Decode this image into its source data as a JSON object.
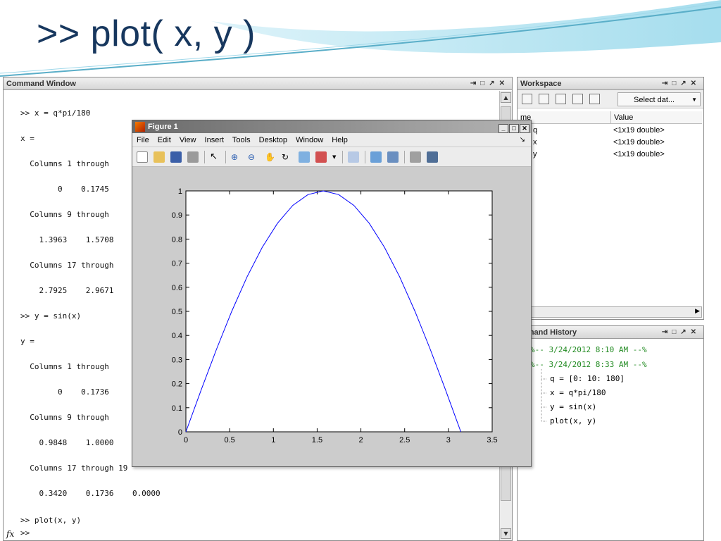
{
  "slide": {
    "title": ">> plot( x, y )"
  },
  "command_window": {
    "title": "Command Window",
    "lines": [
      ">> x = q*pi/180",
      "x =",
      "  Columns 1 through",
      "        0    0.1745",
      "  Columns 9 through",
      "    1.3963    1.5708",
      "  Columns 17 through",
      "    2.7925    2.9671",
      ">> y = sin(x)",
      "y =",
      "  Columns 1 through",
      "        0    0.1736",
      "  Columns 9 through",
      "    0.9848    1.0000",
      "  Columns 17 through 19",
      "    0.3420    0.1736    0.0000",
      ">> plot(x, y)"
    ],
    "fx_label": "fx",
    "prompt": ">>"
  },
  "workspace": {
    "title": "Workspace",
    "select_label": "Select dat...",
    "col_name": "Name",
    "col_name_shown": "me",
    "col_value": "Value",
    "rows": [
      {
        "name": "q",
        "value": "<1x19 double>"
      },
      {
        "name": "x",
        "value": "<1x19 double>"
      },
      {
        "name": "y",
        "value": "<1x19 double>"
      }
    ]
  },
  "command_history": {
    "title": "mmand History",
    "sessions": [
      "%-- 3/24/2012 8:10 AM --%",
      "%-- 3/24/2012 8:33 AM --%"
    ],
    "commands": [
      "q = [0: 10: 180]",
      "x = q*pi/180",
      "y = sin(x)",
      "plot(x, y)"
    ]
  },
  "figure": {
    "title": "Figure 1",
    "menu": [
      "File",
      "Edit",
      "View",
      "Insert",
      "Tools",
      "Desktop",
      "Window",
      "Help"
    ]
  },
  "colors": {
    "title": "#17375e",
    "line": "#0000ff",
    "history_session": "#228b22"
  },
  "chart_data": {
    "type": "line",
    "xlim": [
      0,
      3.5
    ],
    "ylim": [
      0,
      1
    ],
    "xticks": [
      "0",
      "0.5",
      "1",
      "1.5",
      "2",
      "2.5",
      "3",
      "3.5"
    ],
    "yticks": [
      "0",
      "0.1",
      "0.2",
      "0.3",
      "0.4",
      "0.5",
      "0.6",
      "0.7",
      "0.8",
      "0.9",
      "1"
    ],
    "series": [
      {
        "x": [
          0,
          0.1745,
          0.3491,
          0.5236,
          0.6981,
          0.8727,
          1.0472,
          1.2217,
          1.3963,
          1.5708,
          1.7453,
          1.9199,
          2.0944,
          2.2689,
          2.4435,
          2.618,
          2.7925,
          2.9671,
          3.1416
        ],
        "y": [
          0,
          0.1736,
          0.342,
          0.5,
          0.6428,
          0.766,
          0.866,
          0.9397,
          0.9848,
          1.0,
          0.9848,
          0.9397,
          0.866,
          0.766,
          0.6428,
          0.5,
          0.342,
          0.1736,
          0.0
        ]
      }
    ],
    "grid": false
  }
}
